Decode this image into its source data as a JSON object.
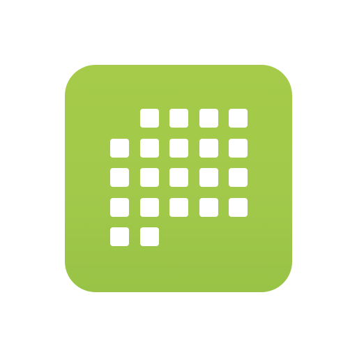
{
  "app_icon": {
    "name": "dot-grid-app-icon",
    "background_color": "#a4ca4a",
    "glyph_color": "#ffffff",
    "glyph": "grid-of-rounded-squares",
    "rows": [
      [
        false,
        true,
        true,
        true,
        true
      ],
      [
        true,
        true,
        true,
        true,
        true
      ],
      [
        true,
        true,
        true,
        true,
        true
      ],
      [
        true,
        true,
        true,
        true,
        true
      ],
      [
        true,
        true,
        false,
        false,
        false
      ]
    ]
  }
}
